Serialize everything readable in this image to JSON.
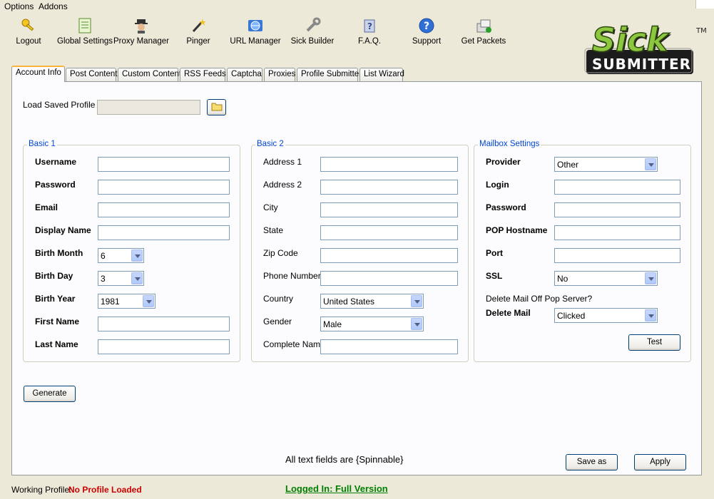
{
  "menubar": {
    "items": [
      "Options",
      "Addons"
    ]
  },
  "toolbar": {
    "items": [
      {
        "label": "Logout",
        "icon": "key-icon"
      },
      {
        "label": "Global Settings",
        "icon": "notepad-icon"
      },
      {
        "label": "Proxy Manager",
        "icon": "spy-icon"
      },
      {
        "label": "Pinger",
        "icon": "magic-wand-icon"
      },
      {
        "label": "URL Manager",
        "icon": "globe-icon"
      },
      {
        "label": "Sick Builder",
        "icon": "wrench-icon"
      },
      {
        "label": "F.A.Q.",
        "icon": "question-book-icon"
      },
      {
        "label": "Support",
        "icon": "help-icon"
      },
      {
        "label": "Get Packets",
        "icon": "packets-icon"
      }
    ]
  },
  "logo": {
    "line1": "Sick",
    "line2": "SUBMITTER",
    "tm": "TM"
  },
  "tabs": [
    "Account Info",
    "Post Content",
    "Custom Content",
    "RSS Feeds",
    "Captcha",
    "Proxies",
    "Profile Submitter",
    "List Wizard"
  ],
  "profile": {
    "label": "Load Saved Profile",
    "value": ""
  },
  "basic1": {
    "title": "Basic 1",
    "username": "Username",
    "password": "Password",
    "email": "Email",
    "display_name": "Display Name",
    "birth_month": "Birth Month",
    "birth_month_value": "6",
    "birth_day": "Birth Day",
    "birth_day_value": "3",
    "birth_year": "Birth Year",
    "birth_year_value": "1981",
    "first_name": "First Name",
    "last_name": "Last Name"
  },
  "basic2": {
    "title": "Basic 2",
    "address1": "Address 1",
    "address2": "Address 2",
    "city": "City",
    "state": "State",
    "zip": "Zip Code",
    "phone": "Phone Number",
    "country": "Country",
    "country_value": "United States",
    "gender": "Gender",
    "gender_value": "Male",
    "complete_name": "Complete Name"
  },
  "mailbox": {
    "title": "Mailbox Settings",
    "provider": "Provider",
    "provider_value": "Other",
    "login": "Login",
    "password": "Password",
    "pop_hostname": "POP Hostname",
    "port": "Port",
    "ssl": "SSL",
    "ssl_value": "No",
    "delete_note": "Delete Mail Off Pop Server?",
    "delete_mail": "Delete Mail",
    "delete_mail_value": "Clicked",
    "test_button": "Test"
  },
  "buttons": {
    "generate": "Generate",
    "save_as": "Save as",
    "apply": "Apply"
  },
  "spin_note": "All text fields are {Spinnable}",
  "status": {
    "working_profile_label": "Working Profile:",
    "working_profile_value": "No Profile Loaded",
    "logged_in": "Logged In: Full Version"
  },
  "colors": {
    "accent": "#0046d5",
    "error": "#cc0000",
    "success": "#008000",
    "logo_green": "#8dc63f"
  }
}
